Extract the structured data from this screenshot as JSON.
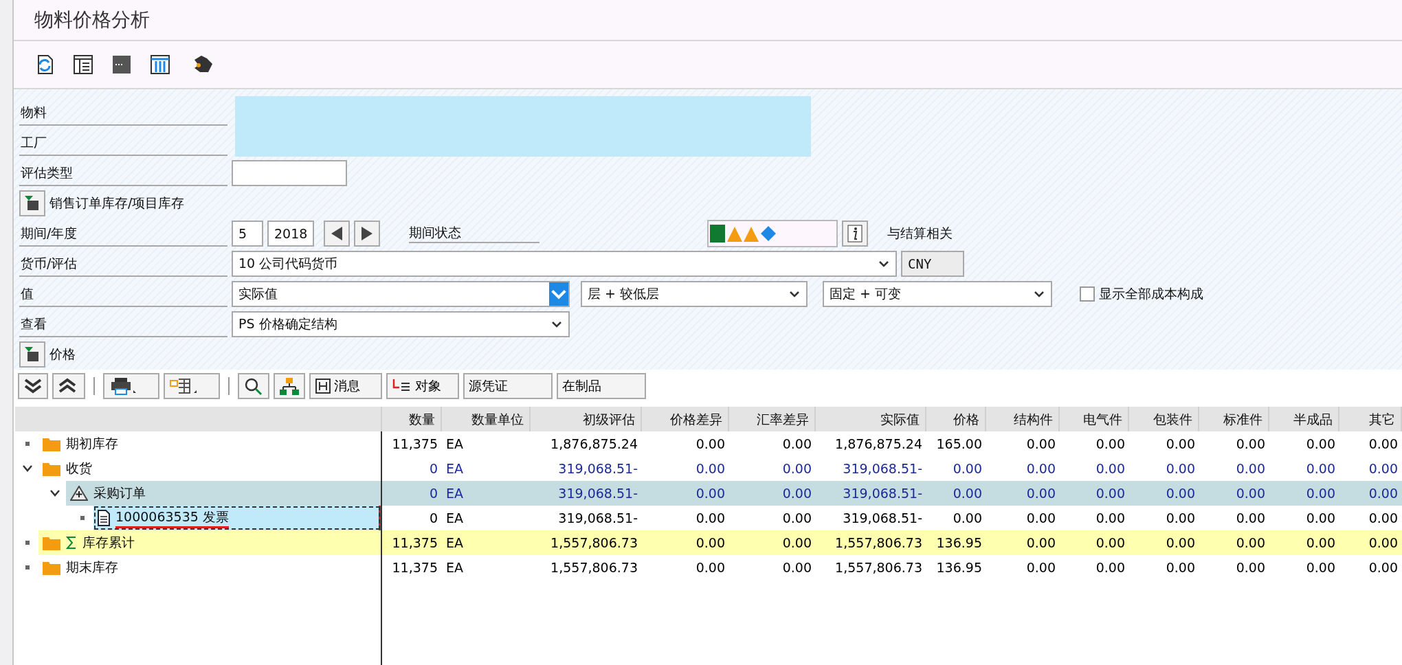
{
  "window": {
    "title": "物料价格分析"
  },
  "form": {
    "material": {
      "label": "物料"
    },
    "plant": {
      "label": "工厂"
    },
    "valuation_type": {
      "label": "评估类型"
    },
    "section_stock": {
      "label": "销售订单库存/项目库存"
    },
    "period": {
      "label": "期间/年度",
      "period": "5",
      "year": "2018",
      "status_label": "期间状态",
      "settlement_label": "与结算相关"
    },
    "currency": {
      "label": "货币/评估",
      "value": "10 公司代码货币",
      "unit": "CNY"
    },
    "values": {
      "label": "值",
      "value": "实际值",
      "level": "层 + 较低层",
      "cost": "固定 + 可变",
      "show_all": {
        "label": "显示全部成本构成",
        "checked": false
      }
    },
    "view": {
      "label": "查看",
      "value": "PS 价格确定结构"
    },
    "section_price": {
      "label": "价格"
    }
  },
  "grid_toolbar": {
    "buttons": [
      {
        "label": "消息"
      },
      {
        "label": "对象"
      },
      {
        "label": "源凭证"
      },
      {
        "label": "在制品"
      }
    ]
  },
  "table": {
    "columns": [
      "数量",
      "数量单位",
      "初级评估",
      "价格差异",
      "汇率差异",
      "实际值",
      "价格",
      "结构件",
      "电气件",
      "包装件",
      "标准件",
      "半成品",
      "其它"
    ],
    "rows": [
      {
        "label": "期初库存",
        "kind": "folder",
        "total": false,
        "selected": false,
        "color": "#000000",
        "cells": [
          "11,375",
          "EA",
          "1,876,875.24",
          "0.00",
          "0.00",
          "1,876,875.24",
          "165.00",
          "0.00",
          "0.00",
          "0.00",
          "0.00",
          "0.00",
          "0.00"
        ]
      },
      {
        "label": "收货",
        "kind": "folder",
        "total": false,
        "selected": false,
        "expanded": true,
        "color": "#1c2a9a",
        "cells": [
          "0",
          "EA",
          "319,068.51-",
          "0.00",
          "0.00",
          "319,068.51-",
          "0.00",
          "0.00",
          "0.00",
          "0.00",
          "0.00",
          "0.00",
          "0.00"
        ],
        "children": [
          {
            "label": "采购订单",
            "kind": "order",
            "total": false,
            "selected": true,
            "expanded": true,
            "color": "#1c2a9a",
            "cells": [
              "0",
              "EA",
              "319,068.51-",
              "0.00",
              "0.00",
              "319,068.51-",
              "0.00",
              "0.00",
              "0.00",
              "0.00",
              "0.00",
              "0.00",
              "0.00"
            ],
            "children": [
              {
                "label": "1000063535 发票",
                "kind": "document",
                "total": false,
                "selected": false,
                "focused": true,
                "color": "#000000",
                "cells": [
                  "0",
                  "EA",
                  "319,068.51-",
                  "0.00",
                  "0.00",
                  "319,068.51-",
                  "0.00",
                  "0.00",
                  "0.00",
                  "0.00",
                  "0.00",
                  "0.00",
                  "0.00"
                ]
              }
            ]
          }
        ]
      },
      {
        "label": "库存累计",
        "kind": "folder",
        "total": true,
        "selected": false,
        "color": "#000000",
        "cells": [
          "11,375",
          "EA",
          "1,557,806.73",
          "0.00",
          "0.00",
          "1,557,806.73",
          "136.95",
          "0.00",
          "0.00",
          "0.00",
          "0.00",
          "0.00",
          "0.00"
        ]
      },
      {
        "label": "期末库存",
        "kind": "folder",
        "total": false,
        "selected": false,
        "color": "#000000",
        "cells": [
          "11,375",
          "EA",
          "1,557,806.73",
          "0.00",
          "0.00",
          "1,557,806.73",
          "136.95",
          "0.00",
          "0.00",
          "0.00",
          "0.00",
          "0.00",
          "0.00"
        ]
      }
    ]
  }
}
